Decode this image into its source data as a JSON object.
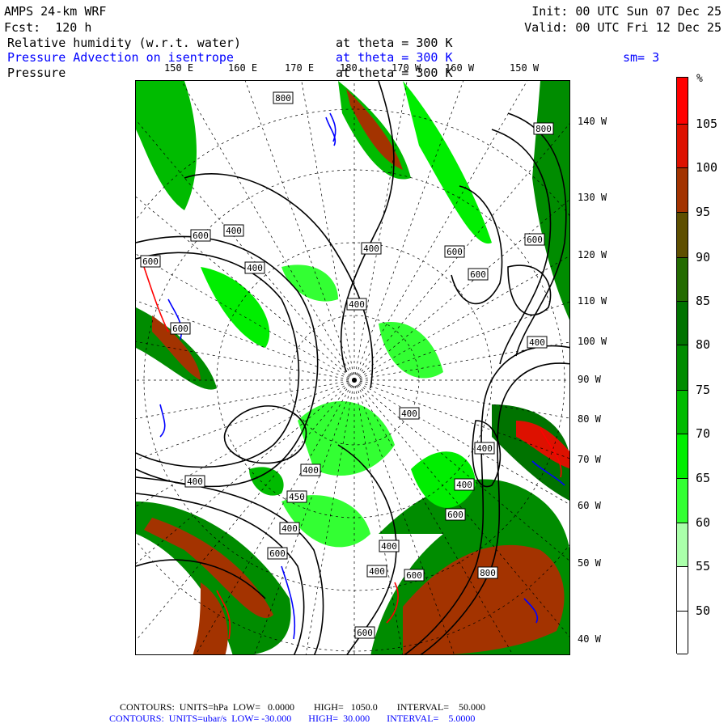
{
  "header": {
    "model": "AMPS 24-km WRF",
    "forecast": "Fcst:  120 h",
    "init": "Init: 00 UTC Sun 07 Dec 25",
    "valid": "Valid: 00 UTC Fri 12 Dec 25",
    "field1": "Relative humidity (w.r.t. water)",
    "field1_level": "at theta = 300 K",
    "field2": "Pressure Advection on isentrope",
    "field2_level": "at theta = 300 K",
    "smoothing": "sm= 3",
    "field3": "Pressure",
    "field3_level": "at theta = 300 K"
  },
  "longitude_labels_top": [
    "150 E",
    "160 E",
    "170 E",
    "180",
    "170 W",
    "160 W",
    "150 W"
  ],
  "longitude_labels_right": [
    "140 W",
    "130 W",
    "120 W",
    "110 W",
    "100 W",
    "90 W",
    "80 W",
    "70 W",
    "60 W",
    "50 W",
    "40 W"
  ],
  "contour_labels": [
    "800",
    "800",
    "600",
    "400",
    "400",
    "600",
    "400",
    "600",
    "600",
    "600",
    "400",
    "600",
    "400",
    "400",
    "400",
    "400",
    "400",
    "450",
    "400",
    "600",
    "400",
    "400",
    "600",
    "400",
    "600",
    "800",
    "600"
  ],
  "colorbar": {
    "unit": "%",
    "labels": [
      "105",
      "100",
      "95",
      "90",
      "85",
      "80",
      "75",
      "70",
      "65",
      "60",
      "55",
      "50"
    ],
    "colors": [
      "#ff0000",
      "#dd1100",
      "#a33300",
      "#5e4f00",
      "#236b00",
      "#007300",
      "#008c00",
      "#00bb00",
      "#00ee00",
      "#33ff33",
      "#aaffaa",
      "#ffffff",
      "#ffffff"
    ]
  },
  "footer": {
    "line1": "CONTOURS:  UNITS=hPa  LOW=   0.0000        HIGH=   1050.0        INTERVAL=    50.000",
    "line2": "CONTOURS:  UNITS=ubar/s  LOW= -30.000       HIGH=  30.000       INTERVAL=    5.0000"
  },
  "colors": {
    "contour": "#000000",
    "advection_positive": "#ff0000",
    "advection_negative": "#0000ff"
  }
}
